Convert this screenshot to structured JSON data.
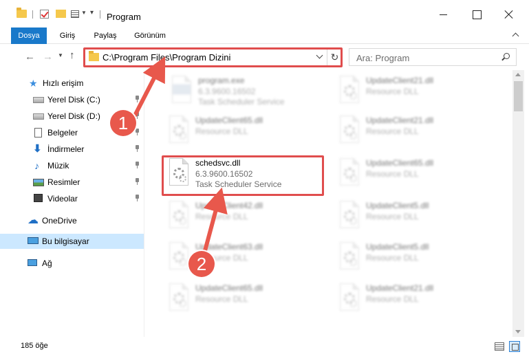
{
  "window": {
    "title": "Program"
  },
  "ribbon": {
    "tabs": [
      "Dosya",
      "Giriş",
      "Paylaş",
      "Görünüm"
    ]
  },
  "address": {
    "path": "C:\\Program Files\\Program Dizini"
  },
  "search": {
    "placeholder": "Ara: Program"
  },
  "sidebar": {
    "items": [
      {
        "label": "Hızlı erişim",
        "icon": "star-icon"
      },
      {
        "label": "Yerel Disk (C:)",
        "icon": "disk-icon",
        "pinned": true
      },
      {
        "label": "Yerel Disk (D:)",
        "icon": "disk-icon",
        "pinned": true
      },
      {
        "label": "Belgeler",
        "icon": "document-icon",
        "pinned": true
      },
      {
        "label": "İndirmeler",
        "icon": "download-icon",
        "pinned": true
      },
      {
        "label": "Müzik",
        "icon": "music-icon",
        "pinned": true
      },
      {
        "label": "Resimler",
        "icon": "picture-icon",
        "pinned": true
      },
      {
        "label": "Videolar",
        "icon": "video-icon",
        "pinned": true
      },
      {
        "label": "OneDrive",
        "icon": "cloud-icon"
      },
      {
        "label": "Bu bilgisayar",
        "icon": "computer-icon",
        "selected": true
      },
      {
        "label": "Ağ",
        "icon": "network-icon"
      }
    ]
  },
  "files": [
    {
      "name": "program.exe",
      "line1": "6.3.9600.16502",
      "line2": "Task Scheduler Service",
      "blurred": true
    },
    {
      "name": "UpdateClient21.dll",
      "line1": "Resource DLL",
      "line2": "",
      "blurred": true
    },
    {
      "name": "UpdateClient65.dll",
      "line1": "Resource DLL",
      "line2": "",
      "blurred": true
    },
    {
      "name": "UpdateClient21.dll",
      "line1": "Resource DLL",
      "line2": "",
      "blurred": true
    },
    {
      "name": "schedsvc.dll",
      "line1": "6.3.9600.16502",
      "line2": "Task Scheduler Service",
      "blurred": false
    },
    {
      "name": "UpdateClient65.dll",
      "line1": "Resource DLL",
      "line2": "",
      "blurred": true
    },
    {
      "name": "UpdateClient42.dll",
      "line1": "Resource DLL",
      "line2": "",
      "blurred": true
    },
    {
      "name": "UpdateClient5.dll",
      "line1": "Resource DLL",
      "line2": "",
      "blurred": true
    },
    {
      "name": "UpdateClient63.dll",
      "line1": "Resource DLL",
      "line2": "",
      "blurred": true
    },
    {
      "name": "UpdateClient5.dll",
      "line1": "Resource DLL",
      "line2": "",
      "blurred": true
    },
    {
      "name": "UpdateClient65.dll",
      "line1": "Resource DLL",
      "line2": "",
      "blurred": true
    },
    {
      "name": "UpdateClient21.dll",
      "line1": "Resource DLL",
      "line2": "",
      "blurred": true
    }
  ],
  "status": {
    "count": "185 öğe"
  },
  "annotations": {
    "badge1": "1",
    "badge2": "2",
    "color": "#e8584c"
  }
}
